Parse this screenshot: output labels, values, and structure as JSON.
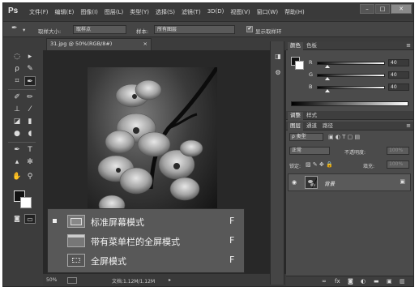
{
  "app": {
    "logo": "Ps"
  },
  "menu": [
    "文件(F)",
    "编辑(E)",
    "图像(I)",
    "图层(L)",
    "类型(Y)",
    "选择(S)",
    "滤镜(T)",
    "3D(D)",
    "视图(V)",
    "窗口(W)",
    "帮助(H)"
  ],
  "window_buttons": {
    "minimize": "–",
    "maximize": "□",
    "close": "✕"
  },
  "options": {
    "sample_size_label": "取样大小:",
    "sample_size_value": "取样点",
    "sample_label": "样本:",
    "sample_value": "所有图层",
    "show_ring_label": "显示取样环",
    "show_ring_checked": "✔"
  },
  "document": {
    "tab_title": "31.jpg @ 50%(RGB/8#)",
    "tab_close": "×",
    "zoom": "50%",
    "doc_info": "文档:1.12M/1.12M"
  },
  "screen_mode_menu": {
    "items": [
      {
        "label": "标准屏幕模式",
        "key": "F"
      },
      {
        "label": "带有菜单栏的全屏模式",
        "key": "F"
      },
      {
        "label": "全屏模式",
        "key": "F"
      }
    ]
  },
  "color_panel": {
    "tabs": [
      "颜色",
      "色板"
    ],
    "menu_icon": "≡",
    "channels": [
      {
        "name": "R",
        "value": "40"
      },
      {
        "name": "G",
        "value": "40"
      },
      {
        "name": "B",
        "value": "40"
      }
    ],
    "foreground": "#111111",
    "background": "#ffffff"
  },
  "adjust_panel": {
    "tabs": [
      "调整",
      "样式"
    ]
  },
  "layers_panel": {
    "tabs": [
      "图层",
      "通道",
      "路径"
    ],
    "filter_label": "ρ 类型",
    "blend_mode": "正常",
    "opacity_label": "不透明度:",
    "opacity_value": "100%",
    "lock_label": "锁定:",
    "fill_label": "填充:",
    "fill_value": "100%",
    "layer_name": "背景",
    "visibility_icon": "◉",
    "lock_icon": "🔒",
    "footer_icons": [
      "∞",
      "fx",
      "◙",
      "◐",
      "▬",
      "▣",
      "🗑"
    ]
  }
}
